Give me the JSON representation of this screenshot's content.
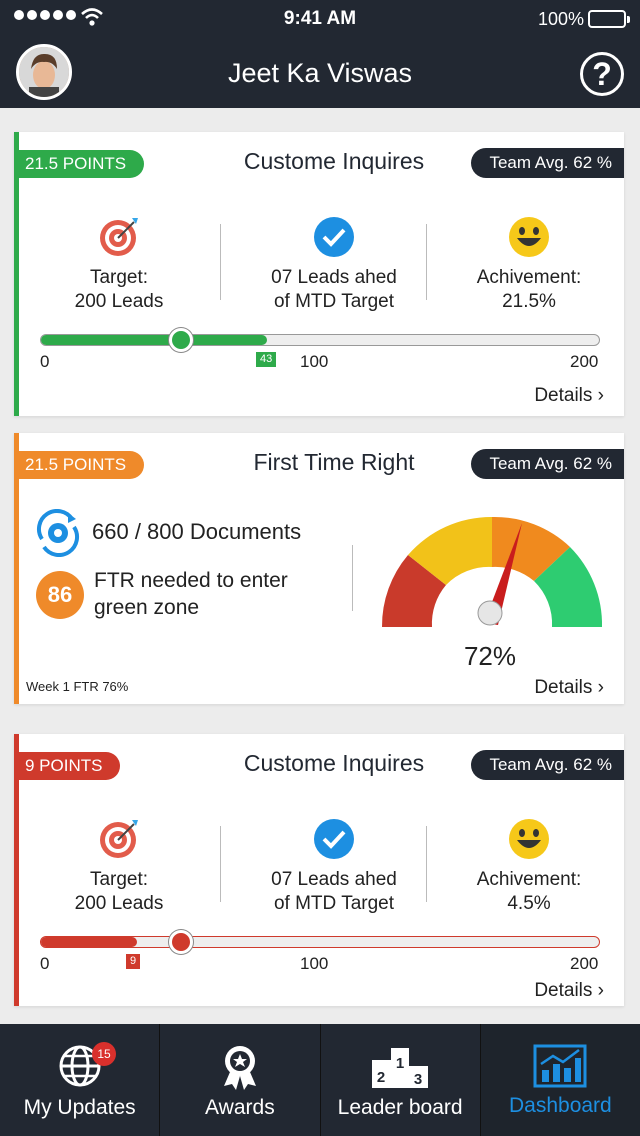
{
  "status_bar": {
    "time": "9:41 AM",
    "battery": "100%"
  },
  "header": {
    "title": "Jeet Ka Viswas",
    "help_label": "?"
  },
  "cards": [
    {
      "points": "21.5 POINTS",
      "title": "Custome Inquires",
      "team_avg": "Team Avg. 62 %",
      "accent": "#2eaa4a",
      "target": {
        "line1": "Target:",
        "line2": "200 Leads"
      },
      "leads": {
        "line1": "07 Leads ahed",
        "line2": "of MTD Target"
      },
      "achievement": {
        "line1": "Achivement:",
        "line2": "21.5%"
      },
      "progress": {
        "min": "0",
        "mid": "100",
        "max": "200",
        "marker": "43",
        "value": 43,
        "knob": 25
      },
      "details": "Details ›"
    },
    {
      "points": "21.5 POINTS",
      "title": "First Time Right",
      "team_avg": "Team Avg. 62 %",
      "accent": "#ef8a2a",
      "documents": "660 / 800 Documents",
      "ftr_number": "86",
      "ftr_text_line1": "FTR needed to enter",
      "ftr_text_line2": "green zone",
      "week_label": "Week 1 FTR 76%",
      "gauge_value": "72%",
      "gauge_percent": 72,
      "details": "Details ›"
    },
    {
      "points": "9 POINTS",
      "title": "Custome Inquires",
      "team_avg": "Team Avg. 62 %",
      "accent": "#cf3a2c",
      "target": {
        "line1": "Target:",
        "line2": "200 Leads"
      },
      "leads": {
        "line1": "07 Leads ahed",
        "line2": "of MTD Target"
      },
      "achievement": {
        "line1": "Achivement:",
        "line2": "4.5%"
      },
      "progress": {
        "min": "0",
        "mid": "100",
        "max": "200",
        "marker": "9",
        "value": 9,
        "knob": 25
      },
      "details": "Details ›"
    }
  ],
  "tabs": [
    {
      "label": "My Updates",
      "icon": "globe-icon",
      "badge": "15"
    },
    {
      "label": "Awards",
      "icon": "award-icon"
    },
    {
      "label": "Leader board",
      "icon": "podium-icon"
    },
    {
      "label": "Dashboard",
      "icon": "chart-icon",
      "active": true
    }
  ]
}
